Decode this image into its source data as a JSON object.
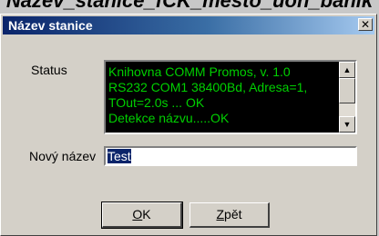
{
  "background_title": "Nazev_stanice_fCK_mesto_uon_banik",
  "dialog": {
    "title": "Název stanice",
    "close_glyph": "✕"
  },
  "status": {
    "label": "Status",
    "lines": [
      "Knihovna COMM Promos, v. 1.0",
      "RS232 COM1 38400Bd, Adresa=1,",
      "TOut=2.0s ... OK",
      "Detekce názvu.....OK"
    ]
  },
  "new_name": {
    "label": "Nový název",
    "value": "Test"
  },
  "buttons": {
    "ok": {
      "accel": "O",
      "rest": "K"
    },
    "back": {
      "accel": "Z",
      "rest": "pět"
    }
  },
  "colors": {
    "titlebar_start": "#0a246a",
    "titlebar_end": "#a6caf0",
    "status_bg": "#000000",
    "status_text": "#00d000",
    "face": "#d4d0c8"
  },
  "icons": {
    "close": "close-icon",
    "scroll_up": "arrow-up-icon",
    "scroll_down": "arrow-down-icon"
  }
}
